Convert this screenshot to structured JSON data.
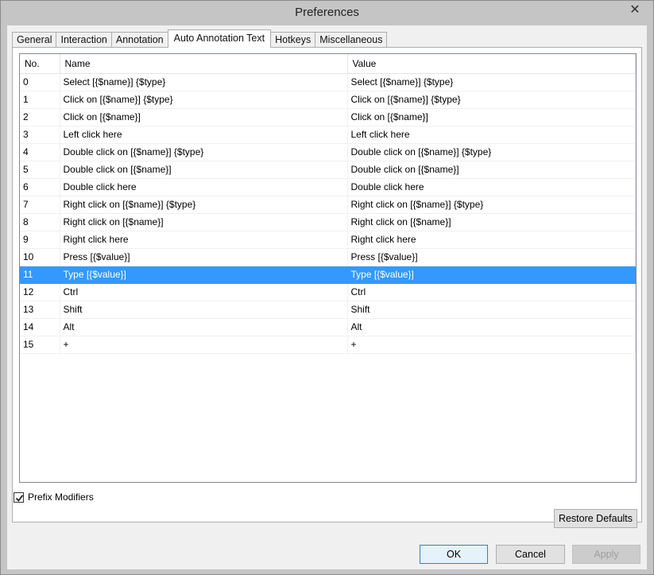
{
  "window": {
    "title": "Preferences",
    "close_glyph": "✕"
  },
  "tabs": [
    {
      "label": "General"
    },
    {
      "label": "Interaction"
    },
    {
      "label": "Annotation"
    },
    {
      "label": "Auto Annotation Text",
      "active": true
    },
    {
      "label": "Hotkeys"
    },
    {
      "label": "Miscellaneous"
    }
  ],
  "table": {
    "headers": {
      "no": "No.",
      "name": "Name",
      "value": "Value"
    },
    "rows": [
      {
        "no": "0",
        "name": "Select [{$name}] {$type}",
        "value": "Select [{$name}] {$type}"
      },
      {
        "no": "1",
        "name": "Click on [{$name}] {$type}",
        "value": "Click on [{$name}] {$type}"
      },
      {
        "no": "2",
        "name": "Click on [{$name}]",
        "value": "Click on [{$name}]"
      },
      {
        "no": "3",
        "name": "Left click here",
        "value": "Left click here"
      },
      {
        "no": "4",
        "name": "Double click on [{$name}] {$type}",
        "value": "Double click on [{$name}] {$type}"
      },
      {
        "no": "5",
        "name": "Double click on [{$name}]",
        "value": "Double click on [{$name}]"
      },
      {
        "no": "6",
        "name": "Double click here",
        "value": "Double click here"
      },
      {
        "no": "7",
        "name": "Right click on [{$name}] {$type}",
        "value": "Right click on [{$name}] {$type}"
      },
      {
        "no": "8",
        "name": "Right click on [{$name}]",
        "value": "Right click on [{$name}]"
      },
      {
        "no": "9",
        "name": "Right click here",
        "value": "Right click here"
      },
      {
        "no": "10",
        "name": "Press [{$value}]",
        "value": "Press [{$value}]"
      },
      {
        "no": "11",
        "name": "Type [{$value}]",
        "value": "Type [{$value}]",
        "selected": true
      },
      {
        "no": "12",
        "name": "Ctrl",
        "value": "Ctrl"
      },
      {
        "no": "13",
        "name": "Shift",
        "value": "Shift"
      },
      {
        "no": "14",
        "name": "Alt",
        "value": "Alt"
      },
      {
        "no": "15",
        "name": "+",
        "value": "+"
      }
    ]
  },
  "prefix_modifiers": {
    "label": "Prefix Modifiers",
    "checked": true
  },
  "buttons": {
    "restore_defaults": "Restore Defaults",
    "ok": "OK",
    "cancel": "Cancel",
    "apply": "Apply"
  },
  "colors": {
    "selection": "#3399ff",
    "titlebar": "#c5c5c5",
    "dialog_bg": "#f0f0f0"
  }
}
